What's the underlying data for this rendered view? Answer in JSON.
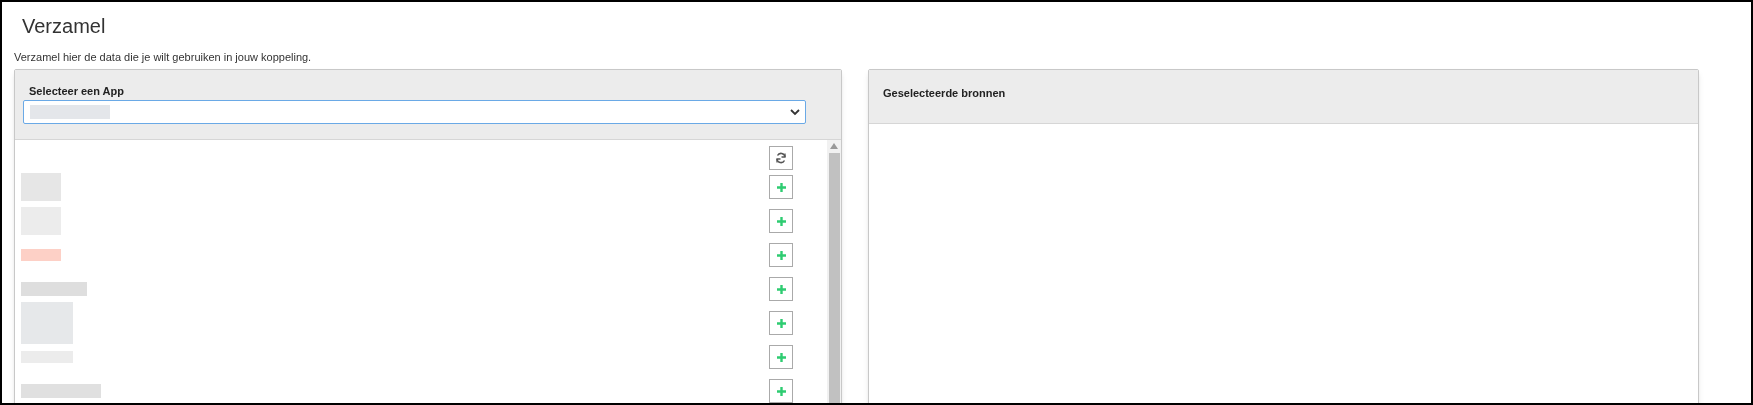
{
  "page": {
    "title": "Verzamel",
    "description": "Verzamel hier de data die je wilt gebruiken in jouw koppeling."
  },
  "app_panel": {
    "label": "Selecteer een App",
    "select": {
      "value_redacted": true
    },
    "items": [
      {
        "color": "#e6e6e6"
      },
      {
        "color": "#ececec"
      },
      {
        "color": "#fdd0c6"
      },
      {
        "color": "#dedede"
      },
      {
        "color": "#e6e8ea"
      },
      {
        "color": "#ececec"
      },
      {
        "color": "#e0e0e0"
      }
    ]
  },
  "sources_panel": {
    "title": "Geselecteerde bronnen"
  }
}
